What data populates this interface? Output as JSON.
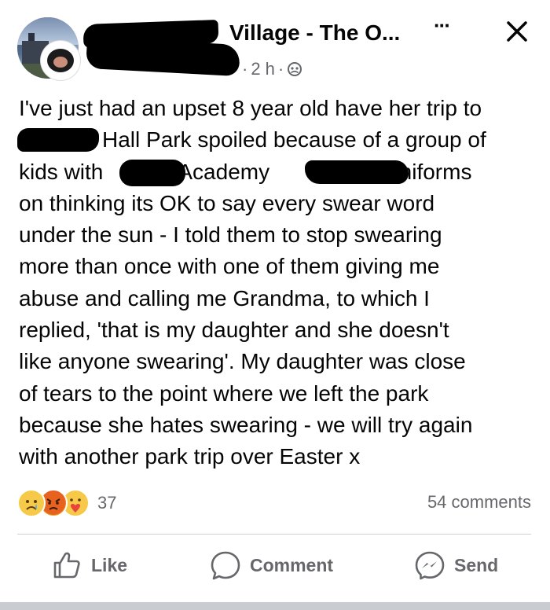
{
  "header": {
    "group_name": "Village - The O...",
    "timestamp": "2 h",
    "separator": "·",
    "more_label": "···"
  },
  "post": {
    "lines": [
      "I've just had an upset 8 year old have her trip to",
      "Hall Park spoiled because of a group of",
      "kids with",
      "Academy",
      "uniforms",
      "on thinking its OK to say every swear word",
      "under the sun - I told them to stop swearing",
      "more than once with one of them giving me",
      "abuse and calling me Grandma, to which I",
      "replied, 'that is my daughter and she doesn't",
      "like anyone swearing'. My daughter was close",
      "of tears to the point where we left the park",
      "because she hates swearing - we will try again",
      "with another park trip over Easter x"
    ]
  },
  "stats": {
    "reaction_count": "37",
    "comments_label": "54 comments"
  },
  "actions": {
    "like": "Like",
    "comment": "Comment",
    "send": "Send"
  },
  "colors": {
    "text": "#050505",
    "secondary": "#65676b",
    "divider": "#ced0d4"
  }
}
